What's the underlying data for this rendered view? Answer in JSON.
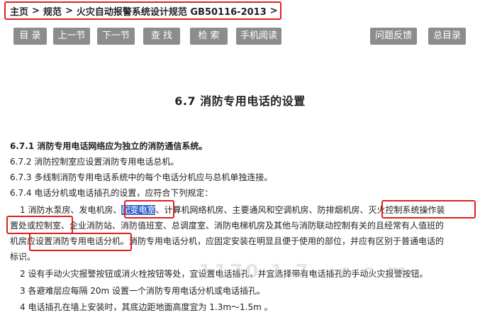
{
  "breadcrumb": {
    "home": "主页",
    "level1": "规范",
    "level2": "火灾自动报警系统设计规范 GB50116-2013",
    "separator": ">"
  },
  "toolbar": {
    "catalog": "目 录",
    "prev": "上一节",
    "next": "下一节",
    "find": "查 找",
    "search": "检 索",
    "mobile": "手机阅读",
    "feedback": "问题反馈",
    "overall_catalog": "总目录"
  },
  "section": {
    "title": "6.7 消防专用电话的设置"
  },
  "content": {
    "p671": "6.7.1 消防专用电话网络应为独立的消防通信系统。",
    "p672": "6.7.2 消防控制室应设置消防专用电话总机。",
    "p673": "6.7.3 多线制消防专用电话系统中的每个电话分机应与总机单独连接。",
    "p674": "6.7.4 电话分机或电话插孔的设置，应符合下列规定：",
    "item1_a": "1 消防水泵房、发电机房、",
    "item1_sel": "配变电室",
    "item1_b": "、计算机网络机房、主要通风和空调机房、防排烟机房、",
    "item1_c": "灭火控制系统操作装",
    "item1_d": "置处或控制室",
    "item1_e": "、企业消防站、消防值班室、总调度室、消防电梯机房及其他与消防联动控制有关的且经常有人值班的",
    "item1_f": "机房",
    "item1_g": "应设置消防专用电话分机",
    "item1_h": "。消防专用电话分机，应固定安装在明显且便于使用的部位，并应有区别于普通电话的",
    "item1_i": "标识。",
    "item2": "2 设有手动火灾报警按钮或消火栓按钮等处，宜设置电话插孔，并宜选择带有电话插孔的手动火灾报警按钮。",
    "item3": "3 各避难层应每隔 20m 设置一个消防专用电话分机或电话插孔。",
    "item4": "4 电话插孔在墙上安装时，其底边距地面高度宜为 1.3m～1.5m 。"
  },
  "watermark": "1170 1 7 . c o m",
  "colors": {
    "button_bg": "#8c8c8c",
    "highlight_box": "#e02020",
    "selection": "#3366cc"
  }
}
